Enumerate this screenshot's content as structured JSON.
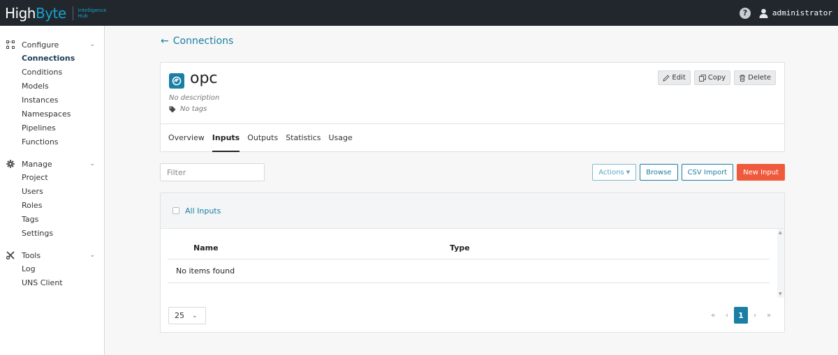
{
  "topbar": {
    "logo_main": "High",
    "logo_accent": "Byte",
    "logo_sub_line1": "Intelligence",
    "logo_sub_line2": "Hub",
    "help_symbol": "?",
    "username": "administrator",
    "icons": {
      "help": "help-circle-icon",
      "user": "user-icon"
    }
  },
  "sidebar": {
    "groups": [
      {
        "label": "Configure",
        "icon": "network-icon",
        "items": [
          "Connections",
          "Conditions",
          "Models",
          "Instances",
          "Namespaces",
          "Pipelines",
          "Functions"
        ],
        "active": "Connections"
      },
      {
        "label": "Manage",
        "icon": "gear-icon",
        "items": [
          "Project",
          "Users",
          "Roles",
          "Tags",
          "Settings"
        ]
      },
      {
        "label": "Tools",
        "icon": "tools-icon",
        "items": [
          "Log",
          "UNS Client"
        ]
      }
    ]
  },
  "breadcrumb": {
    "back_label": "Connections"
  },
  "connection": {
    "name": "opc",
    "description": "No description",
    "tags": "No tags",
    "actions": {
      "edit": "Edit",
      "copy": "Copy",
      "delete": "Delete"
    },
    "tabs": [
      "Overview",
      "Inputs",
      "Outputs",
      "Statistics",
      "Usage"
    ],
    "active_tab": "Inputs"
  },
  "toolbar": {
    "filter_placeholder": "Filter",
    "actions_label": "Actions",
    "browse_label": "Browse",
    "csv_import_label": "CSV Import",
    "new_input_label": "New Input"
  },
  "table": {
    "select_all_label": "All Inputs",
    "columns": [
      "Name",
      "Type"
    ],
    "empty_text": "No items found",
    "page_size": "25",
    "current_page": "1",
    "pager_first": "«",
    "pager_prev": "‹",
    "pager_next": "›",
    "pager_last": "»"
  },
  "colors": {
    "brand": "#1a7ea5",
    "danger": "#f05a3c",
    "topbar": "#21272d"
  }
}
